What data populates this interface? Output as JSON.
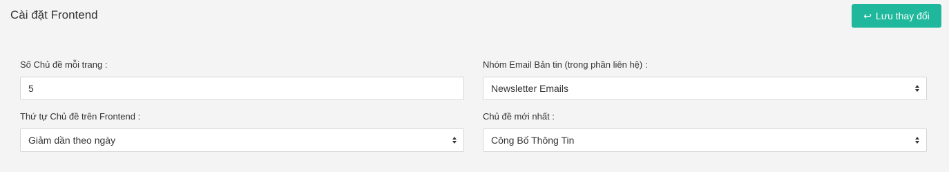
{
  "header": {
    "title": "Cài đặt Frontend",
    "save_label": "Lưu thay đổi",
    "save_icon": "return-arrow-icon",
    "save_color": "#1fb89c"
  },
  "form": {
    "topics_per_page": {
      "label": "Số Chủ đề mỗi trang :",
      "value": "5"
    },
    "newsletter_group": {
      "label": "Nhóm Email Bản tin (trong phần liên hệ) :",
      "selected": "Newsletter Emails"
    },
    "topic_order": {
      "label": "Thứ tự Chủ đề trên Frontend :",
      "selected": "Giảm dần theo ngày"
    },
    "latest_topic": {
      "label": "Chủ đề mới nhất :",
      "selected": "Công Bố Thông Tin"
    }
  }
}
